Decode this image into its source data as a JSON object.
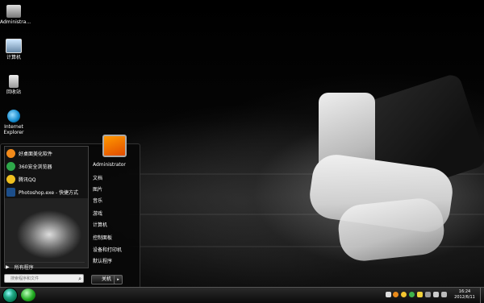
{
  "desktop_icons": [
    {
      "label": "Administra..."
    },
    {
      "label": "计算机"
    },
    {
      "label": "回收站"
    },
    {
      "label": "Internet Explorer"
    }
  ],
  "start_menu": {
    "programs": [
      {
        "label": "好桌面美化软件",
        "icon": "flower-icon",
        "color": "#f28a1a"
      },
      {
        "label": "360安全浏览器",
        "icon": "browser-icon",
        "color": "#2ea84a"
      },
      {
        "label": "腾讯QQ",
        "icon": "penguin-icon",
        "color": "#f0c020"
      },
      {
        "label": "Photoshop.exe - 快捷方式",
        "icon": "photoshop-icon",
        "color": "#1c4e8a"
      }
    ],
    "all_programs": "所有程序",
    "search_placeholder": "搜索程序和文件",
    "right_links": [
      "Administrator",
      "文档",
      "图片",
      "音乐",
      "游戏",
      "计算机",
      "控制面板",
      "设备和打印机",
      "默认程序"
    ],
    "shutdown_label": "关机"
  },
  "taskbar": {
    "time": "16:24",
    "date": "2012/6/11"
  }
}
